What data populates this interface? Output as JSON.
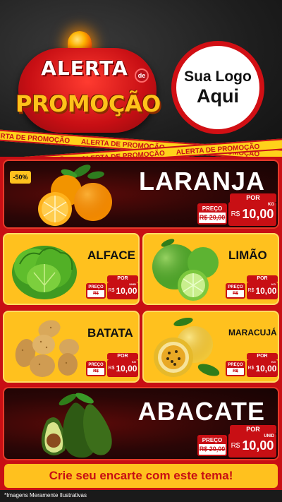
{
  "header": {
    "alerta": "ALERTA",
    "de": "de",
    "promocao": "PROMOÇÃO",
    "logo_line1": "Sua Logo",
    "logo_line2": "Aqui",
    "tape_text": "ALERTA DE PROMOÇÃO"
  },
  "products": {
    "laranja": {
      "name": "LARANJA",
      "discount": "-50%",
      "por": "POR",
      "preco_label": "PREÇO",
      "old_price": "R$ 20,00",
      "currency": "R$",
      "price": "10,00",
      "unit": "KG"
    },
    "alface": {
      "name": "ALFACE",
      "por": "POR",
      "preco_label": "PREÇO",
      "old_price": "R$ 20,00",
      "currency": "R$",
      "price": "10,00",
      "unit": "UNID"
    },
    "limao": {
      "name": "LIMÃO",
      "por": "POR",
      "preco_label": "PREÇO",
      "old_price": "R$ 20,00",
      "currency": "R$",
      "price": "10,00",
      "unit": "KG"
    },
    "batata": {
      "name": "BATATA",
      "por": "POR",
      "preco_label": "PREÇO",
      "old_price": "R$ 20,00",
      "currency": "R$",
      "price": "10,00",
      "unit": "KG"
    },
    "maracuja": {
      "name": "MARACUJÁ",
      "por": "POR",
      "preco_label": "PREÇO",
      "old_price": "R$ 20,00",
      "currency": "R$",
      "price": "10,00",
      "unit": "KG"
    },
    "abacate": {
      "name": "ABACATE",
      "por": "POR",
      "preco_label": "PREÇO",
      "old_price": "R$ 20,00",
      "currency": "R$",
      "price": "10,00",
      "unit": "UNID"
    }
  },
  "cta": "Crie seu encarte com este tema!",
  "disclaimer": "*Imagens Meramente Ilustrativas",
  "colors": {
    "red": "#c80f14",
    "yellow": "#ffc11e",
    "dark": "#1a1a1a"
  }
}
